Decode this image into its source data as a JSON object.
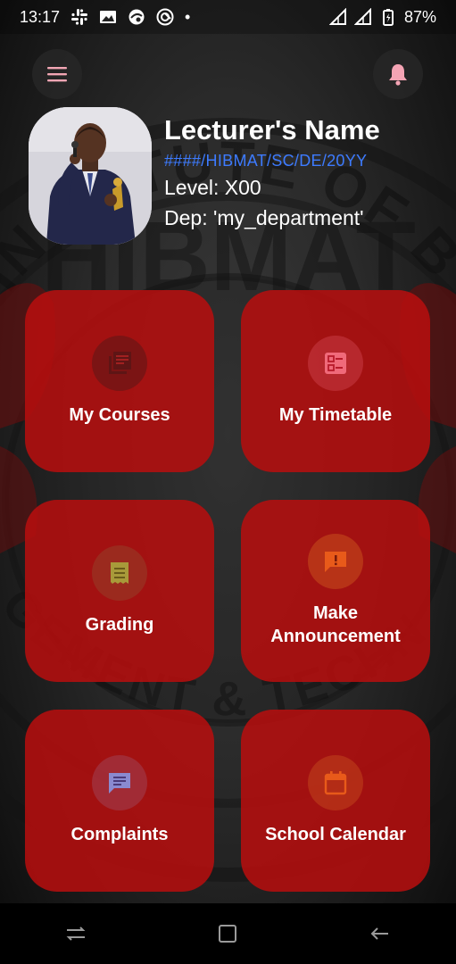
{
  "status_bar": {
    "time": "13:17",
    "battery": "87%",
    "dot": "•"
  },
  "header": {
    "menu_icon": "hamburger-icon",
    "notification_icon": "bell-icon"
  },
  "profile": {
    "name": "Lecturer's Name",
    "reg_no": "####/HIBMAT/SC/DE/20YY",
    "level": "Level: X00",
    "department": "Dep: 'my_department'"
  },
  "watermark": {
    "top_text": "INSTITUTE OF BU",
    "center_text": "HIBMAT",
    "side_text": "GEMENT & TECHN"
  },
  "tiles": [
    {
      "label": "My Courses",
      "icon": "library-books-icon"
    },
    {
      "label": "My Timetable",
      "icon": "checklist-icon"
    },
    {
      "label": "Grading",
      "icon": "receipt-icon"
    },
    {
      "label": "Make\nAnnouncement",
      "icon": "announcement-icon"
    },
    {
      "label": "Complaints",
      "icon": "message-icon"
    },
    {
      "label": "School Calendar",
      "icon": "calendar-icon"
    }
  ],
  "colors": {
    "tile_bg": "#b80e0e",
    "reg_no_blue": "#3d7bff",
    "icon_circle_brown": "#8a2a1c",
    "icon_dark": "#6b1a1a",
    "icon_pink": "#f06a7a",
    "icon_olive": "#a89a3a",
    "icon_orange": "#e85a1a",
    "icon_lavender": "#8a8ad0"
  },
  "nav_bar": {
    "recents_icon": "recents-icon",
    "home_icon": "home-square-icon",
    "back_icon": "back-arrow-icon"
  }
}
